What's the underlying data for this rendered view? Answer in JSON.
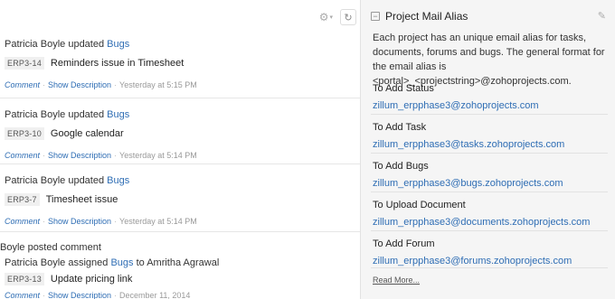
{
  "feed": {
    "activities": [
      {
        "actor": "Patricia Boyle",
        "verb": "updated",
        "target": "Bugs",
        "task_id": "ERP3-14",
        "task_title": "Reminders issue in Timesheet",
        "comment_label": "Comment",
        "show_desc_label": "Show Description",
        "timestamp": "Yesterday at 5:15 PM"
      },
      {
        "actor": "Patricia Boyle",
        "verb": "updated",
        "target": "Bugs",
        "task_id": "ERP3-10",
        "task_title": "Google calendar",
        "comment_label": "Comment",
        "show_desc_label": "Show Description",
        "timestamp": "Yesterday at 5:14 PM"
      },
      {
        "actor": "Patricia Boyle",
        "verb": "updated",
        "target": "Bugs",
        "task_id": "ERP3-7",
        "task_title": "Timesheet issue",
        "comment_label": "Comment",
        "show_desc_label": "Show Description",
        "timestamp": "Yesterday at 5:14 PM"
      },
      {
        "header": "Boyle posted comment",
        "actor": "Patricia Boyle",
        "verb": "assigned",
        "target": "Bugs",
        "suffix": "to Amritha Agrawal",
        "task_id": "ERP3-13",
        "task_title": "Update pricing link",
        "comment_label": "Comment",
        "show_desc_label": "Show Description",
        "timestamp": "December 11, 2014"
      }
    ]
  },
  "panel": {
    "title": "Project Mail Alias",
    "description": "Each project has an unique email alias for tasks, documents, forums and bugs. The general format for the email alias is <portal>_<projectstring>@zohoprojects.com.",
    "aliases": [
      {
        "label": "To Add Status",
        "email": "zillum_erpphase3@zohoprojects.com"
      },
      {
        "label": "To Add Task",
        "email": "zillum_erpphase3@tasks.zohoprojects.com"
      },
      {
        "label": "To Add Bugs",
        "email": "zillum_erpphase3@bugs.zohoprojects.com"
      },
      {
        "label": "To Upload Document",
        "email": "zillum_erpphase3@documents.zohoprojects.com"
      },
      {
        "label": "To Add Forum",
        "email": "zillum_erpphase3@forums.zohoprojects.com"
      }
    ],
    "read_more": "Read More..."
  },
  "icons": {
    "gear": "gear-icon",
    "history": "history-icon",
    "collapse": "collapse-icon",
    "edit": "pencil-icon"
  },
  "colors": {
    "link": "#2e6db4",
    "panel_bg": "#f5f5f5"
  }
}
